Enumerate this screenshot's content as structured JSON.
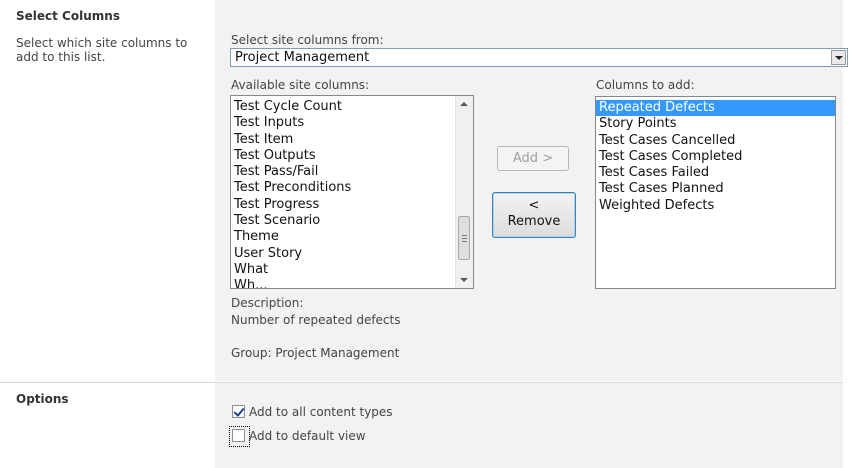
{
  "select_columns": {
    "title": "Select Columns",
    "description": "Select which site columns to add to this list.",
    "select_from_label": "Select site columns from:",
    "select_from_value": "Project Management",
    "available_label": "Available site columns:",
    "available_items": [
      "Test Cycle Count",
      "Test Inputs",
      "Test Item",
      "Test Outputs",
      "Test Pass/Fail",
      "Test Preconditions",
      "Test Progress",
      "Test Scenario",
      "Theme",
      "User Story",
      "What",
      "Wh..."
    ],
    "add_button": "Add >",
    "remove_button_line1": "<",
    "remove_button_line2": "Remove",
    "columns_to_add_label": "Columns to add:",
    "columns_to_add_items": [
      "Repeated Defects",
      "Story Points",
      "Test Cases Cancelled",
      "Test Cases Completed",
      "Test Cases Failed",
      "Test Cases Planned",
      "Weighted Defects"
    ],
    "description_label": "Description:",
    "description_value": "Number of repeated defects",
    "group_text": "Group: Project Management"
  },
  "options": {
    "title": "Options",
    "add_to_all_content_types": "Add to all content types",
    "add_to_all_checked": true,
    "add_to_default_view": "Add to default view",
    "add_to_default_checked": false
  },
  "colors": {
    "selection": "#3399ff",
    "section_bg": "#f2f2f2"
  },
  "icons": {
    "dropdown": "chevron-down-icon",
    "scroll_up": "scroll-up-icon",
    "scroll_down": "scroll-down-icon"
  }
}
